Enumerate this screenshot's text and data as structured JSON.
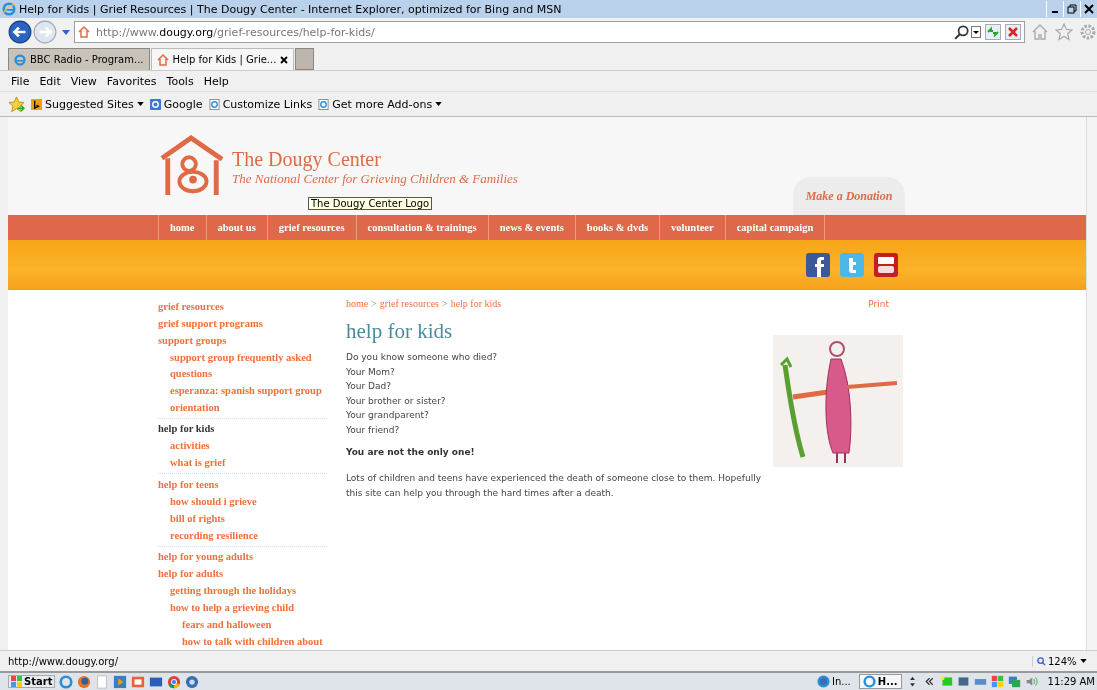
{
  "window": {
    "title": "Help for Kids | Grief Resources | The Dougy Center - Internet Explorer, optimized for Bing and MSN"
  },
  "address_bar": {
    "url_prefix": "http://www.",
    "url_domain": "dougy.org",
    "url_path": "/grief-resources/help-for-kids/"
  },
  "tabs": [
    {
      "label": "BBC Radio - Program...",
      "selected": false
    },
    {
      "label": "Help for Kids | Grie...",
      "selected": true
    }
  ],
  "menu": [
    "File",
    "Edit",
    "View",
    "Favorites",
    "Tools",
    "Help"
  ],
  "favorites": [
    {
      "label": "Suggested Sites",
      "kind": "bing",
      "dropdown": true
    },
    {
      "label": "Google",
      "kind": "google",
      "dropdown": false
    },
    {
      "label": "Customize Links",
      "kind": "page",
      "dropdown": false
    },
    {
      "label": "Get more Add-ons",
      "kind": "page",
      "dropdown": true
    }
  ],
  "site": {
    "name": "The Dougy Center",
    "tagline": "The National Center for Grieving Children & Families",
    "tooltip": "The Dougy Center Logo",
    "donate": "Make a Donation",
    "nav": [
      "home",
      "about us",
      "grief resources",
      "consultation & trainings",
      "news & events",
      "books & dvds",
      "volunteer",
      "capital campaign"
    ]
  },
  "sidebar": {
    "items": [
      {
        "label": "grief resources",
        "selected": false
      },
      {
        "label": "grief support programs",
        "selected": false
      },
      {
        "label": "support groups",
        "selected": false,
        "children": [
          {
            "label": "support group frequently asked questions",
            "selected": false
          },
          {
            "label": "esperanza: spanish support group",
            "selected": false
          },
          {
            "label": "orientation",
            "selected": false
          }
        ]
      },
      {
        "label": "help for kids",
        "selected": true,
        "children": [
          {
            "label": "activities",
            "selected": false
          },
          {
            "label": "what is grief",
            "selected": false
          }
        ]
      },
      {
        "label": "help for teens",
        "selected": false,
        "children": [
          {
            "label": "how should i grieve",
            "selected": false
          },
          {
            "label": "bill of rights",
            "selected": false
          },
          {
            "label": "recording resilience",
            "selected": false
          }
        ]
      },
      {
        "label": "help for young adults",
        "selected": false
      },
      {
        "label": "help for adults",
        "selected": false,
        "children": [
          {
            "label": "getting through the holidays",
            "selected": false
          },
          {
            "label": "how to help a grieving child",
            "selected": false,
            "children": [
              {
                "label": "fears and halloween",
                "selected": false
              },
              {
                "label": "how to talk with children about",
                "selected": false
              }
            ]
          }
        ]
      }
    ]
  },
  "breadcrumb": [
    {
      "label": "home",
      "kind": "link"
    },
    {
      "label": ">",
      "kind": "separator"
    },
    {
      "label": "grief resources",
      "kind": "link"
    },
    {
      "label": ">",
      "kind": "separator"
    },
    {
      "label": "help for kids",
      "kind": "link"
    }
  ],
  "print": "Print",
  "heading": "help for kids",
  "questions": [
    "Do you know someone who died?",
    "Your Mom?",
    "Your Dad?",
    "Your brother or sister?",
    "Your grandparent?",
    "Your friend?"
  ],
  "emphasis": "You are not the only one!",
  "paragraph": "Lots of children and teens have experienced the death of someone close to them. Hopefully this site can help you through the hard times after a death.",
  "status_bar": {
    "url": "http://www.dougy.org/",
    "zoom": "124%"
  },
  "taskbar": {
    "start": "Start",
    "tasks": [
      {
        "label": "In...",
        "selected": false
      },
      {
        "label": "H...",
        "selected": true
      }
    ],
    "clock": "11:29 AM"
  }
}
